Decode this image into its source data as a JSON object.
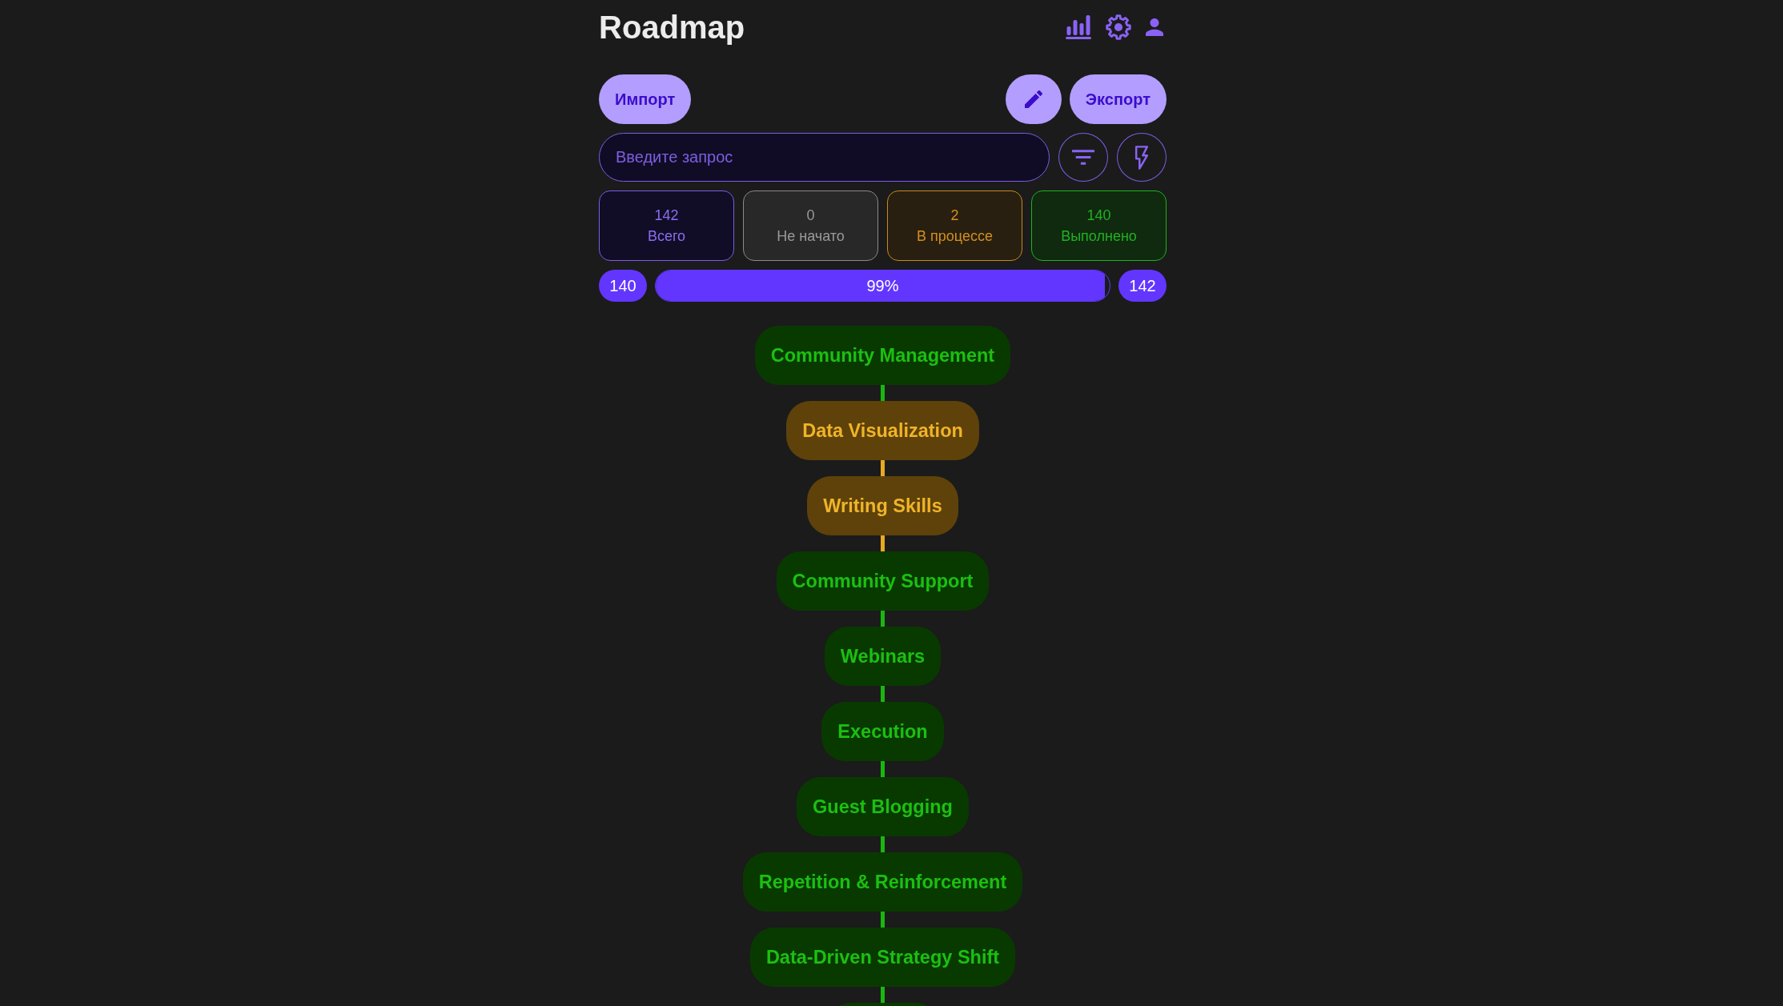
{
  "header": {
    "title": "Roadmap"
  },
  "toolbar": {
    "import_button": "Импорт",
    "export_button": "Экспорт"
  },
  "search": {
    "placeholder": "Введите запрос"
  },
  "stats": [
    {
      "kind": "total",
      "value": "142",
      "label": "Всего"
    },
    {
      "kind": "not_started",
      "value": "0",
      "label": "Не начато"
    },
    {
      "kind": "in_progress",
      "value": "2",
      "label": "В процессе"
    },
    {
      "kind": "done",
      "value": "140",
      "label": "Выполнено"
    }
  ],
  "progress": {
    "done": "140",
    "level": 0.99,
    "reading": "99%",
    "total": "142"
  },
  "roadmap": {
    "nodes": [
      {
        "label": "Community Management",
        "kind": "done"
      },
      {
        "label": "Data Visualization",
        "kind": "in_progress"
      },
      {
        "label": "Writing Skills",
        "kind": "in_progress"
      },
      {
        "label": "Community Support",
        "kind": "done"
      },
      {
        "label": "Webinars",
        "kind": "done"
      },
      {
        "label": "Execution",
        "kind": "done"
      },
      {
        "label": "Guest Blogging",
        "kind": "done"
      },
      {
        "label": "Repetition & Reinforcement",
        "kind": "done"
      },
      {
        "label": "Data-Driven Strategy Shift",
        "kind": "done"
      },
      {
        "kind": "done"
      }
    ]
  }
}
